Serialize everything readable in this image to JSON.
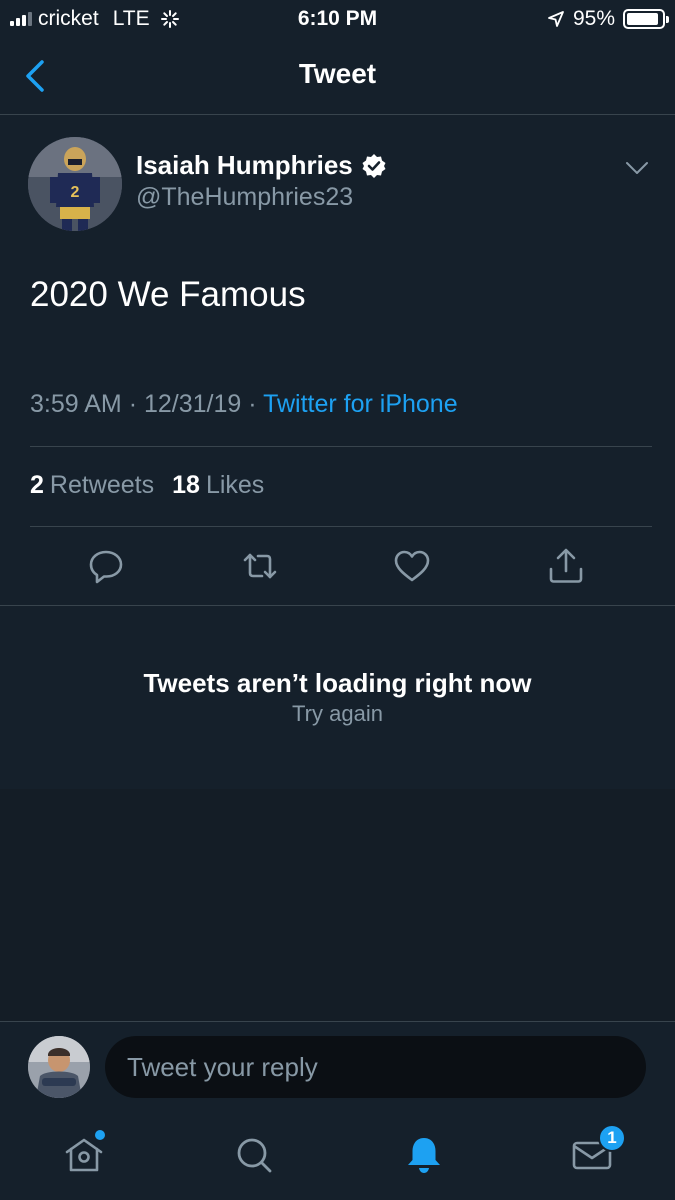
{
  "status_bar": {
    "carrier": "cricket",
    "network": "LTE",
    "time": "6:10 PM",
    "battery": "95%",
    "battery_level": 0.95
  },
  "nav": {
    "title": "Tweet",
    "back_icon": "chevron-left-icon"
  },
  "tweet": {
    "author_name": "Isaiah Humphries",
    "author_handle": "@TheHumphries23",
    "verified": true,
    "text": "2020 We Famous",
    "time": "3:59 AM",
    "sep1": "·",
    "date": "12/31/19",
    "sep2": "·",
    "source": "Twitter for iPhone",
    "retweet_count": "2",
    "retweet_label": "Retweets",
    "like_count": "18",
    "like_label": "Likes"
  },
  "actions": [
    "reply-icon",
    "retweet-icon",
    "like-icon",
    "share-icon"
  ],
  "error": {
    "title": "Tweets aren’t loading right now",
    "retry": "Try again"
  },
  "reply": {
    "placeholder": "Tweet your reply"
  },
  "tab_bar": {
    "items": [
      "home-icon",
      "search-icon",
      "notifications-icon",
      "messages-icon"
    ],
    "messages_badge": "1"
  },
  "colors": {
    "background": "#15202b",
    "accent": "#1da1f2",
    "secondary_text": "#8899a6",
    "divider": "#38444d"
  }
}
